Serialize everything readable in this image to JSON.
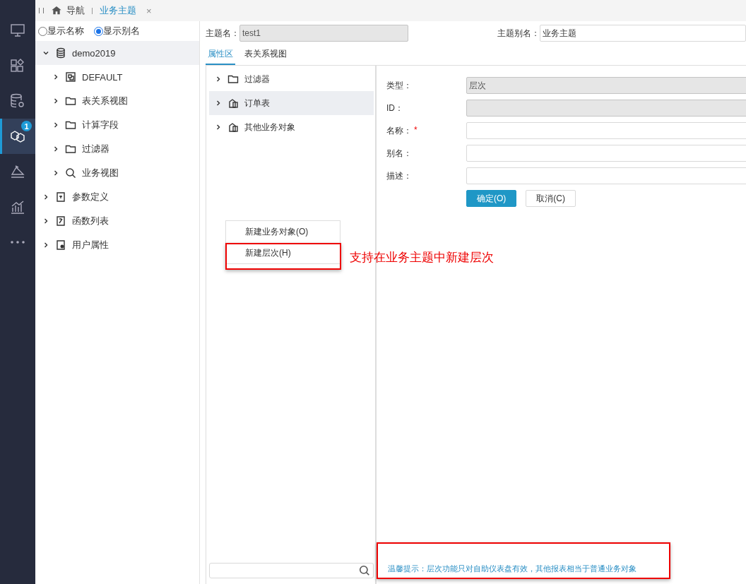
{
  "nav_rail": [
    {
      "kind": "monitor",
      "selected": false
    },
    {
      "kind": "apps",
      "selected": false
    },
    {
      "kind": "database-gear",
      "selected": false
    },
    {
      "kind": "cubes",
      "selected": true,
      "badge": "1"
    },
    {
      "kind": "ruler",
      "selected": false
    },
    {
      "kind": "chart",
      "selected": false
    },
    {
      "kind": "more",
      "selected": false
    }
  ],
  "tabs": [
    {
      "kind": "home",
      "label": "导航",
      "selected": false
    },
    {
      "label": "业务主题",
      "selected": true,
      "close": "×"
    }
  ],
  "display_mode": [
    {
      "label": "显示名称",
      "selected": false
    },
    {
      "label": "显示别名",
      "selected": true
    }
  ],
  "tree": [
    {
      "kind": "database",
      "label": "demo2019",
      "expanded": true,
      "selected": true,
      "children": [
        {
          "kind": "grid",
          "label": "DEFAULT",
          "expanded": false,
          "selected": false
        },
        {
          "kind": "folder",
          "label": "表关系视图",
          "expanded": false,
          "selected": false
        },
        {
          "kind": "folder",
          "label": "计算字段",
          "expanded": false,
          "selected": false
        },
        {
          "kind": "folder",
          "label": "过滤器",
          "expanded": false,
          "selected": false
        },
        {
          "kind": "search",
          "label": "业务视图",
          "expanded": false,
          "selected": false
        }
      ]
    },
    {
      "kind": "param",
      "label": "参数定义",
      "expanded": false,
      "selected": false
    },
    {
      "kind": "function",
      "label": "函数列表",
      "expanded": false,
      "selected": false
    },
    {
      "kind": "user",
      "label": "用户属性",
      "expanded": false,
      "selected": false
    }
  ],
  "topic": {
    "name_label": "主题名：",
    "name": "test1",
    "alias_label": "主题别名：",
    "alias": "业务主题"
  },
  "sub_tabs": [
    {
      "label": "属性区",
      "selected": true
    },
    {
      "label": "表关系视图",
      "selected": false
    }
  ],
  "objects": [
    {
      "kind": "folder",
      "label": "过滤器",
      "selected": false
    },
    {
      "kind": "table",
      "label": "订单表",
      "selected": true
    },
    {
      "kind": "table",
      "label": "其他业务对象",
      "selected": false
    }
  ],
  "context_menu": [
    {
      "label": "新建业务对象(O)",
      "highlighted": false
    },
    {
      "label": "新建层次(H)",
      "highlighted": true
    }
  ],
  "annotation": "支持在业务主题中新建层次",
  "form": {
    "fields": [
      {
        "label": "类型：",
        "value": "层次",
        "disabled": true
      },
      {
        "label": "ID：",
        "disabled": true
      },
      {
        "label": "名称：",
        "disabled": false,
        "required_mark": "*"
      },
      {
        "label": "别名：",
        "disabled": false
      },
      {
        "label": "描述：",
        "disabled": false
      }
    ],
    "buttons": [
      {
        "label": "确定(O)",
        "primary": true
      },
      {
        "label": "取消(C)",
        "primary": false
      }
    ]
  },
  "hint": {
    "text": "温馨提示：层次功能只对自助仪表盘有效，其他报表相当于普通业务对象",
    "highlighted": true
  }
}
